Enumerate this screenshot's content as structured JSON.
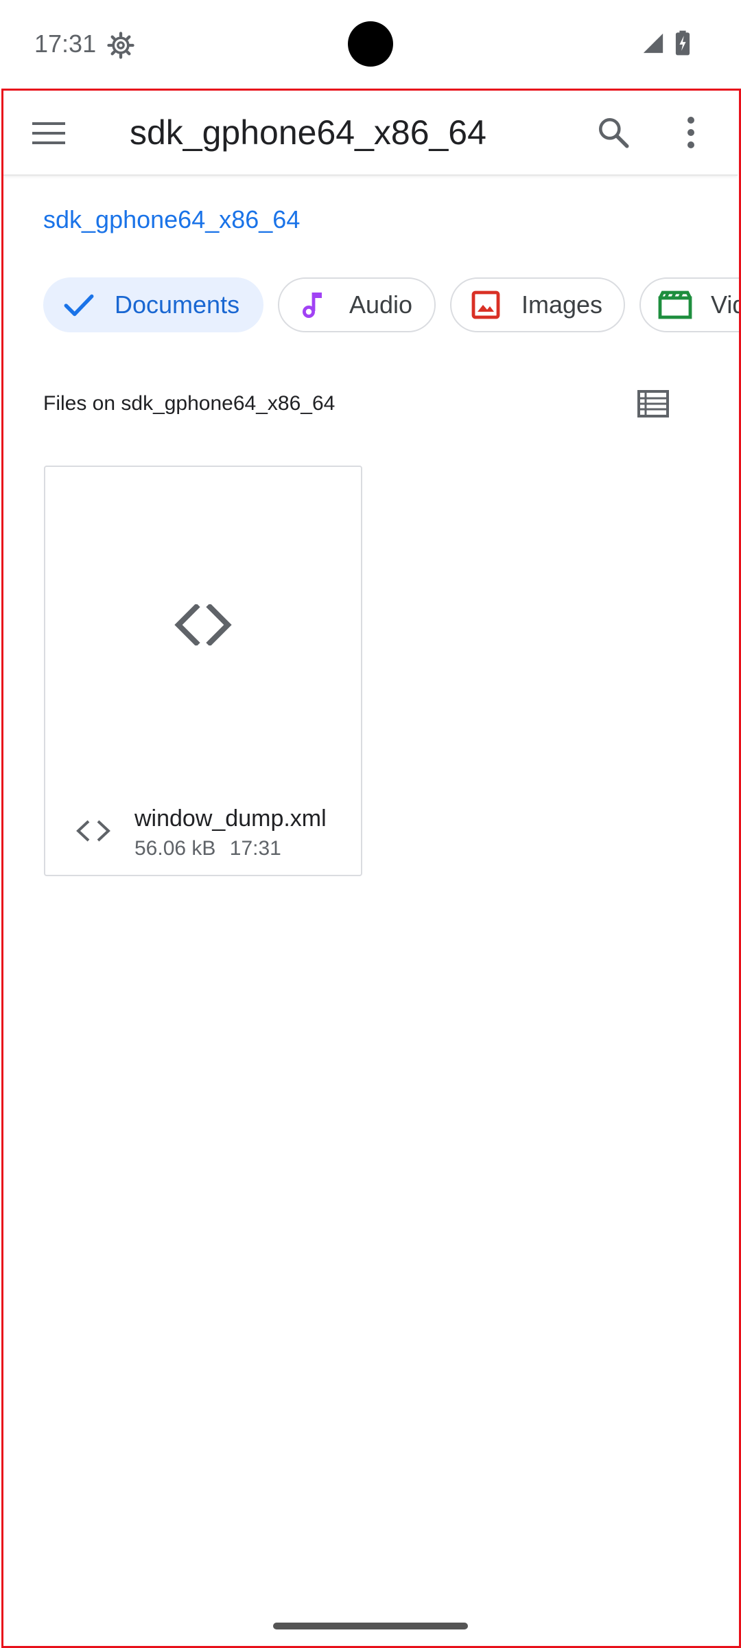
{
  "status_bar": {
    "time": "17:31"
  },
  "toolbar": {
    "title": "sdk_gphone64_x86_64",
    "menu_icon": "hamburger-menu-icon",
    "search_icon": "search-icon",
    "more_icon": "more-vert-icon"
  },
  "breadcrumb": {
    "root": "sdk_gphone64_x86_64"
  },
  "chips": [
    {
      "label": "Documents",
      "icon": "check-icon",
      "selected": true,
      "color": "#1a73e8"
    },
    {
      "label": "Audio",
      "icon": "music-note-icon",
      "selected": false,
      "color": "#a142f4"
    },
    {
      "label": "Images",
      "icon": "image-icon",
      "selected": false,
      "color": "#d93025"
    },
    {
      "label": "Vid",
      "icon": "movie-icon",
      "selected": false,
      "color": "#1e8e3e"
    }
  ],
  "section": {
    "header": "Files on sdk_gphone64_x86_64",
    "view_toggle_icon": "list-view-icon"
  },
  "files": [
    {
      "name": "window_dump.xml",
      "size": "56.06 kB",
      "time": "17:31",
      "icon": "code-icon"
    }
  ],
  "colors": {
    "accent": "#1a73e8",
    "highlight_frame": "#e8111b"
  }
}
